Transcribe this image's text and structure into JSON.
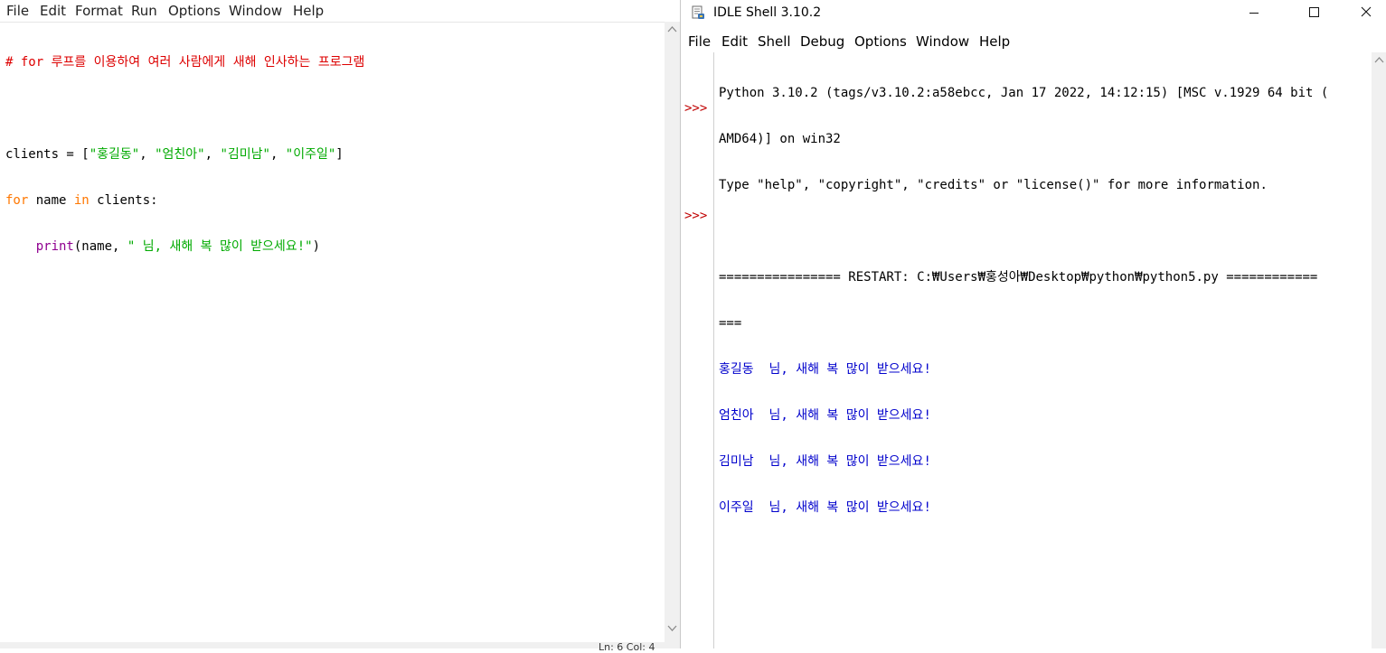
{
  "editor": {
    "menu": [
      "File",
      "Edit",
      "Format",
      "Run",
      "Options",
      "Window",
      "Help"
    ],
    "code": {
      "line1": "# for 루프를 이용하여 여러 사람에게 새해 인사하는 프로그램",
      "line2": "",
      "line3_a": "clients = [",
      "line3_s1": "\"홍길동\"",
      "line3_c1": ", ",
      "line3_s2": "\"엄친아\"",
      "line3_c2": ", ",
      "line3_s3": "\"김미남\"",
      "line3_c3": ", ",
      "line3_s4": "\"이주일\"",
      "line3_b": "]",
      "line4_kw1": "for",
      "line4_a": " name ",
      "line4_kw2": "in",
      "line4_b": " clients:",
      "line5_indent": "    ",
      "line5_builtin": "print",
      "line5_a": "(name, ",
      "line5_str": "\" 님, 새해 복 많이 받으세요!\"",
      "line5_b": ")"
    },
    "status": "Ln: 6   Col: 4"
  },
  "shell": {
    "title": "IDLE Shell 3.10.2",
    "menu": [
      "File",
      "Edit",
      "Shell",
      "Debug",
      "Options",
      "Window",
      "Help"
    ],
    "prompt": ">>>",
    "banner": [
      "Python 3.10.2 (tags/v3.10.2:a58ebcc, Jan 17 2022, 14:12:15) [MSC v.1929 64 bit (",
      "AMD64)] on win32",
      "Type \"help\", \"copyright\", \"credits\" or \"license()\" for more information."
    ],
    "restart": [
      "================ RESTART: C:₩Users₩홍성아₩Desktop₩python₩python5.py ============",
      "==="
    ],
    "output": [
      "홍길동  님, 새해 복 많이 받으세요!",
      "엄친아  님, 새해 복 많이 받으세요!",
      "김미남  님, 새해 복 많이 받으세요!",
      "이주일  님, 새해 복 많이 받으세요!"
    ],
    "colors": {
      "output": "#0000cc",
      "prompt": "#c00000"
    }
  },
  "icons": {
    "scroll_up": "scroll-up-icon",
    "scroll_down": "scroll-down-icon",
    "minimize": "minimize-icon",
    "maximize": "maximize-icon",
    "close": "close-icon",
    "app": "idle-app-icon"
  }
}
